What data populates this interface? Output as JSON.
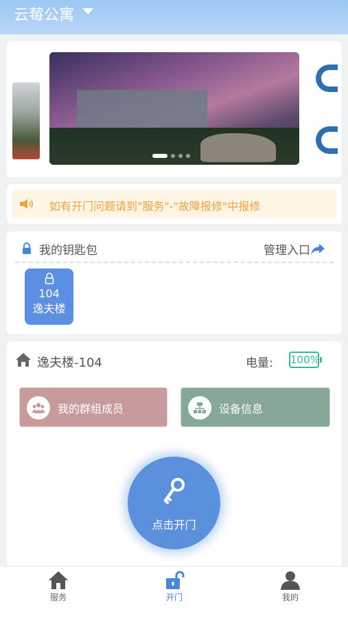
{
  "header": {
    "title": "云莓公寓"
  },
  "notice": {
    "text": "如有开门问题请到\"服务\"-\"故障报修\"中报修"
  },
  "keys": {
    "title": "我的钥匙包",
    "manage_label": "管理入口",
    "items": [
      {
        "room": "104",
        "building": "逸夫楼"
      }
    ]
  },
  "room": {
    "name": "逸夫楼-104",
    "battery_label": "电量:",
    "battery_value": "100%",
    "group_button": "我的群组成员",
    "device_button": "设备信息",
    "open_button": "点击开门"
  },
  "nav": {
    "items": [
      {
        "label": "服务",
        "icon": "home-icon"
      },
      {
        "label": "开门",
        "icon": "unlock-icon"
      },
      {
        "label": "我的",
        "icon": "user-icon"
      }
    ]
  },
  "colors": {
    "primary": "#5a90dc",
    "notice_text": "#f2a23a",
    "group_button": "#c99a9c",
    "device_button": "#87a897",
    "battery": "#39b79a"
  }
}
